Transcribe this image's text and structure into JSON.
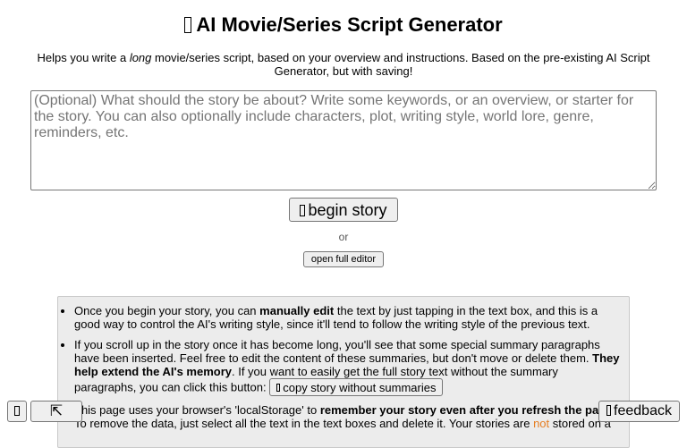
{
  "header": {
    "title_icon": "glyph-icon",
    "title": "AI Movie/Series Script Generator",
    "subtitle_pre": "Helps you write a ",
    "subtitle_em": "long",
    "subtitle_post": " movie/series script, based on your overview and instructions. Based on the pre-existing AI Script Generator, but with saving!"
  },
  "prompt": {
    "placeholder": "(Optional) What should the story be about? Write some keywords, or an overview, or starter for the story. You can also optionally include characters, plot, writing style, world lore, genre, reminders, etc.",
    "value": ""
  },
  "actions": {
    "begin_icon": "glyph-icon",
    "begin_label": "begin story",
    "or_label": "or",
    "editor_label": "open full editor"
  },
  "help": {
    "item1": {
      "t1": "Once you begin your story, you can ",
      "b1": "manually edit",
      "t2": " the text by just tapping in the text box, and this is a good way to control the AI's writing style, since it'll tend to follow the writing style of the previous text."
    },
    "item2": {
      "t1": "If you scroll up in the story once it has become long, you'll see that some special summary paragraphs have been inserted. Feel free to edit the content of these summaries, but don't move or delete them. ",
      "b1": "They help extend the AI's memory",
      "t2": ". If you want to easily get the full story text without the summary paragraphs, you can click this button: ",
      "copy_icon": "glyph-icon",
      "copy_label": "copy story without summaries"
    },
    "item3": {
      "t1": "This page uses your browser's 'localStorage' to ",
      "b1": "remember your story even after you refresh the page",
      "t2": ". To remove the data, just select all the text in the text boxes and delete it. Your stories are ",
      "not": "not",
      "t3": " stored on a"
    }
  },
  "floating": {
    "menu_icon": "glyph-icon",
    "collapse_icon": "arrow-up-left-icon",
    "collapse_glyph": "⇱",
    "feedback_icon": "glyph-icon",
    "feedback_label": "feedback"
  },
  "colors": {
    "not_highlight": "#e67e22",
    "panel_bg": "#ececec",
    "button_bg": "#efefef"
  }
}
